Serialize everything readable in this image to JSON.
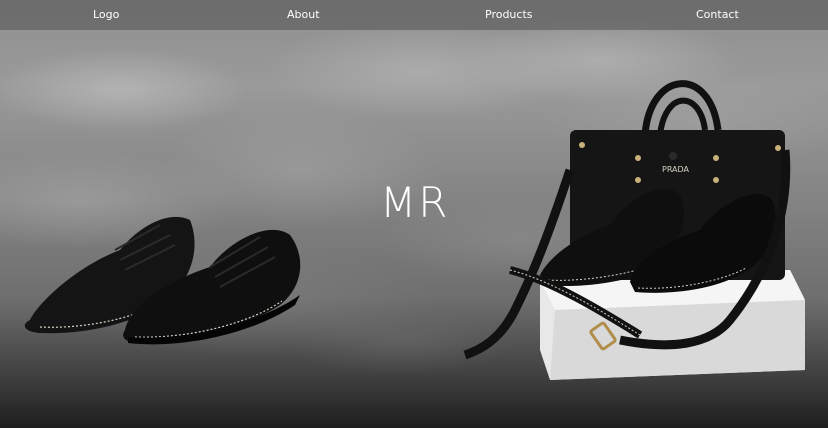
{
  "nav": {
    "logo": "Logo",
    "about": "About",
    "products": "Products",
    "contact": "Contact"
  },
  "hero": {
    "title": "MR",
    "left_image_icon": "shoes-icon",
    "right_image_icon": "bag-and-shoes-icon",
    "bag_brand": "PRADA"
  },
  "colors": {
    "nav_text": "#ffffff",
    "title_text": "#ffffff",
    "product_black": "#151515",
    "box_white": "#e8e8e8",
    "stitch": "#d8d2c4"
  }
}
